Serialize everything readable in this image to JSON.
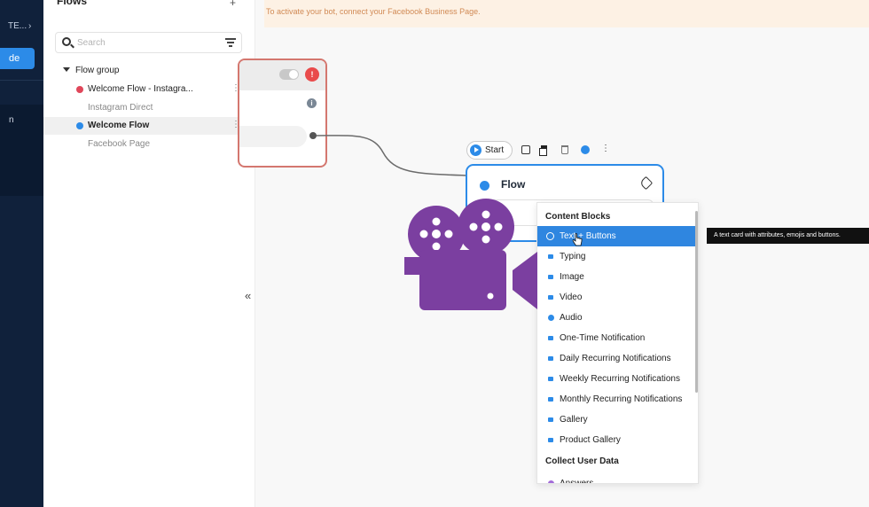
{
  "rail": {
    "workspace_label": "TE...",
    "workspace_chevron": "›",
    "button_label": "de",
    "panel_label": "n"
  },
  "flows_panel": {
    "title": "Flows",
    "title_more": "+",
    "search_placeholder": "Search",
    "group_label": "Flow group",
    "flows": [
      {
        "name": "Welcome Flow - Instagra...",
        "channel": "Instagram Direct",
        "status_color": "#e0475a",
        "selected": false
      },
      {
        "name": "Welcome Flow",
        "channel": "Facebook Page",
        "status_color": "#2c8be8",
        "selected": true
      }
    ],
    "row_more": "⋮",
    "collapse_label": "«"
  },
  "banner": {
    "text": "To activate your bot, connect your Facebook Business Page."
  },
  "prev_node": {
    "warning_glyph": "!",
    "info_glyph": "i"
  },
  "toolbar": {
    "start_label": "Start",
    "more_glyph": "⋮"
  },
  "flow_node": {
    "title": "Flow"
  },
  "menu": {
    "section_content": "Content Blocks",
    "content_items": [
      "Text + Buttons",
      "Typing",
      "Image",
      "Video",
      "Audio",
      "One-Time Notification",
      "Daily Recurring Notifications",
      "Weekly Recurring Notifications",
      "Monthly Recurring Notifications",
      "Gallery",
      "Product Gallery"
    ],
    "highlighted_index": 0,
    "section_collect": "Collect User Data",
    "collect_items": [
      "Answers"
    ]
  },
  "tooltip": {
    "text": "A text card with attributes, emojis and buttons."
  },
  "colors": {
    "accent": "#2c8be8",
    "sidebar": "#10213b",
    "overlay_camera": "#7b3fa0",
    "banner_bg": "#fdf1e4"
  },
  "icons": {
    "overlay": "video-camera-icon"
  }
}
